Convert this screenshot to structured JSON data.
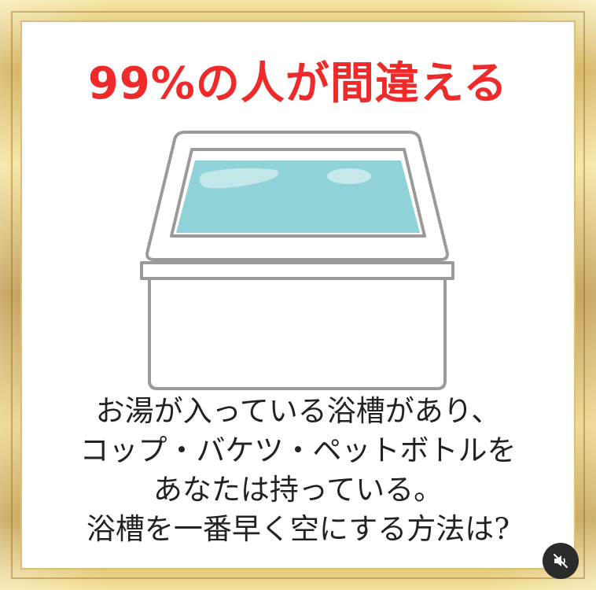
{
  "headline": "99%の人が間違える",
  "question": {
    "lines": [
      "お湯が入っている浴槽があり、",
      "コップ・バケツ・ペットボトルを",
      "あなたは持っている。",
      "浴槽を一番早く空にする方法は?"
    ]
  },
  "colors": {
    "headline": "#ee2a2a",
    "water": "#8fd3d8",
    "tub_outline": "#9a9a9a",
    "frame_gold": "#c89a2c"
  },
  "icons": {
    "mute": "muted-speaker-icon"
  }
}
